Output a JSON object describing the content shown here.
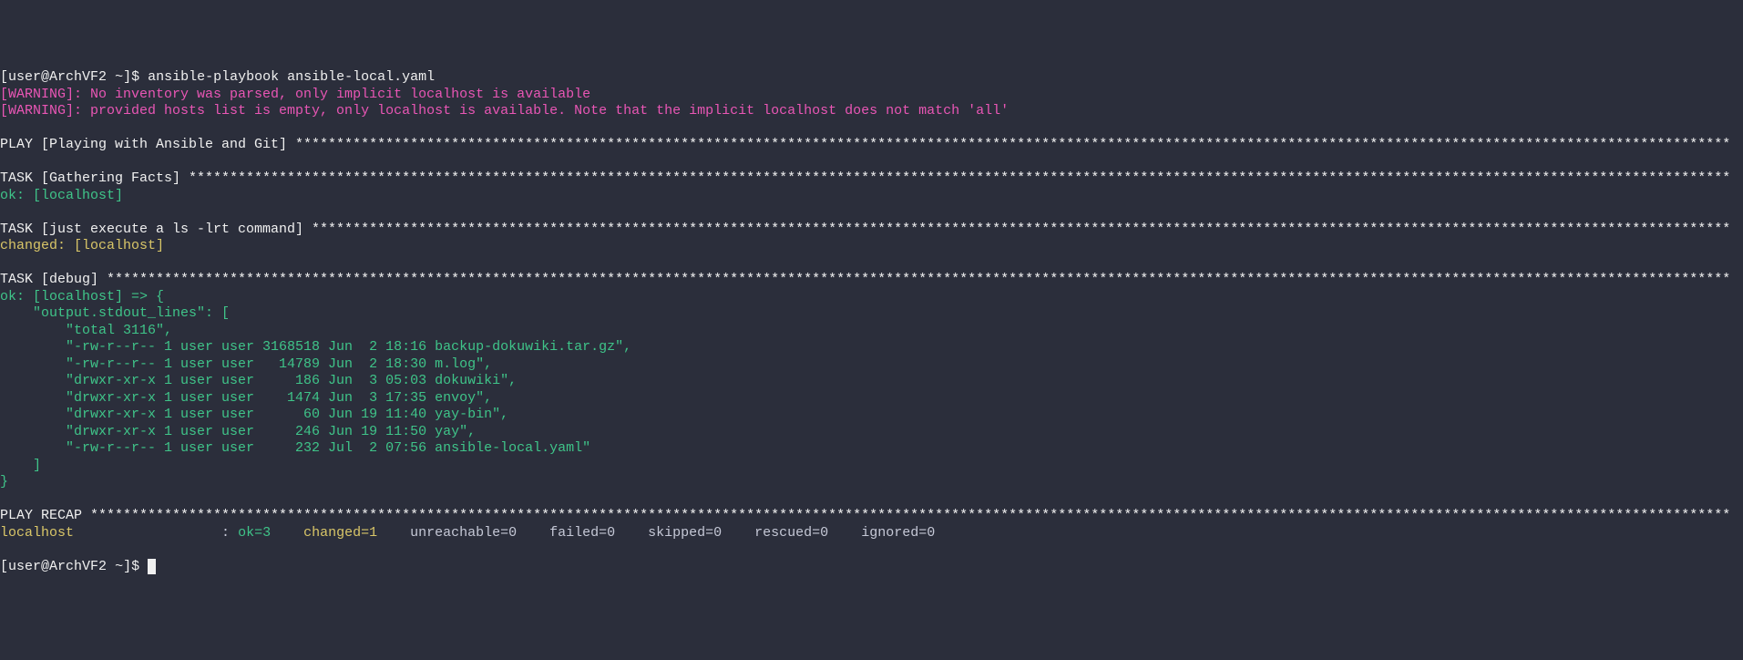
{
  "prompt1": {
    "open": "[",
    "user": "user",
    "at": "@",
    "host": "ArchVF2",
    "path": " ~",
    "close": "]",
    "dollar": "$ ",
    "command": "ansible-playbook ansible-local.yaml"
  },
  "warning1": "[WARNING]: No inventory was parsed, only implicit localhost is available",
  "warning2": "[WARNING]: provided hosts list is empty, only localhost is available. Note that the implicit localhost does not match 'all'",
  "blank": "",
  "play_header": "PLAY [Playing with Ansible and Git] *******************************************************************************************************************************************************************************",
  "task_facts_header": "TASK [Gathering Facts] ********************************************************************************************************************************************************************************************",
  "task_facts_result": "ok: [localhost]",
  "task_ls_header": "TASK [just execute a ls -lrt command] *****************************************************************************************************************************************************************************",
  "task_ls_result": "changed: [localhost]",
  "task_debug_header": "TASK [debug] ******************************************************************************************************************************************************************************************************",
  "debug_lines": [
    "ok: [localhost] => {",
    "    \"output.stdout_lines\": [",
    "        \"total 3116\",",
    "        \"-rw-r--r-- 1 user user 3168518 Jun  2 18:16 backup-dokuwiki.tar.gz\",",
    "        \"-rw-r--r-- 1 user user   14789 Jun  2 18:30 m.log\",",
    "        \"drwxr-xr-x 1 user user     186 Jun  3 05:03 dokuwiki\",",
    "        \"drwxr-xr-x 1 user user    1474 Jun  3 17:35 envoy\",",
    "        \"drwxr-xr-x 1 user user      60 Jun 19 11:40 yay-bin\",",
    "        \"drwxr-xr-x 1 user user     246 Jun 19 11:50 yay\",",
    "        \"-rw-r--r-- 1 user user     232 Jul  2 07:56 ansible-local.yaml\"",
    "    ]",
    "}"
  ],
  "recap_header": "PLAY RECAP ********************************************************************************************************************************************************************************************************",
  "recap": {
    "host": "localhost                  ",
    "colon": ": ",
    "ok": "ok=3   ",
    "changed": " changed=1   ",
    "rest": " unreachable=0    failed=0    skipped=0    rescued=0    ignored=0"
  },
  "prompt2": {
    "open": "[",
    "user": "user",
    "at": "@",
    "host": "ArchVF2",
    "path": " ~",
    "close": "]",
    "dollar": "$ "
  }
}
